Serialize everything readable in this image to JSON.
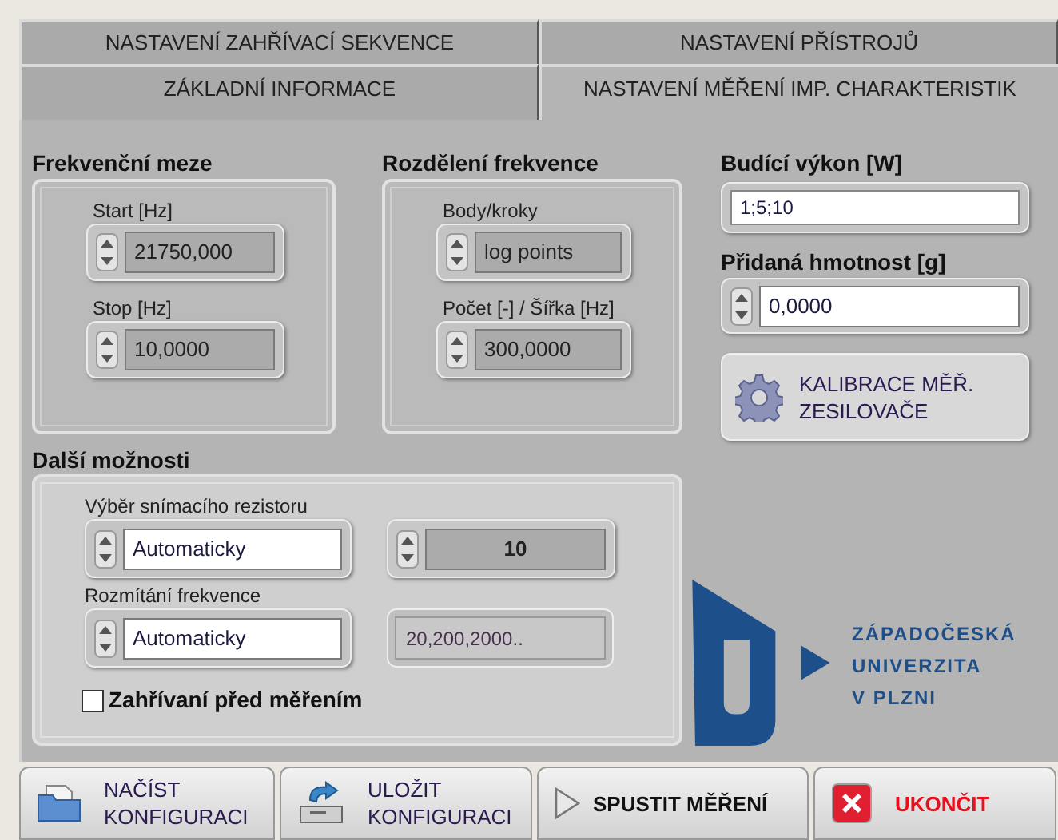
{
  "tab_rows": [
    {
      "tabs": [
        {
          "label": "NASTAVENÍ ZAHŘÍVACÍ  SEKVENCE",
          "selected": false
        },
        {
          "label": "NASTAVENÍ PŘÍSTROJŮ",
          "selected": false
        }
      ]
    },
    {
      "tabs": [
        {
          "label": "ZÁKLADNÍ INFORMACE",
          "selected": false
        },
        {
          "label": "NASTAVENÍ MĚŘENÍ IMP. CHARAKTERISTIK",
          "selected": true
        }
      ]
    }
  ],
  "frequency_limits": {
    "title": "Frekvenční meze",
    "fields": [
      {
        "label": "Start [Hz]",
        "value": "21750,000",
        "disabled": true
      },
      {
        "label": "Stop [Hz]",
        "value": "10,0000",
        "disabled": true
      }
    ]
  },
  "frequency_division": {
    "title": "Rozdělení frekvence",
    "fields": [
      {
        "label": "Body/kroky",
        "value": "log points",
        "disabled": true
      },
      {
        "label": "Počet [-] / Šířka [Hz]",
        "value": "300,0000",
        "disabled": true
      }
    ]
  },
  "drive_power": {
    "title": "Budící výkon [W]",
    "value": "1;5;10"
  },
  "added_mass": {
    "title": "Přidaná hmotnost [g]",
    "value": "0,0000",
    "disabled": false
  },
  "calibration_button": {
    "label": "KALIBRACE MĚŘ. ZESILOVAČE"
  },
  "more_options": {
    "title": "Další možnosti",
    "resistor": {
      "label": "Výběr snímacího rezistoru",
      "mode": "Automaticky",
      "mode_disabled": false,
      "value": "10",
      "value_disabled": true
    },
    "sweep": {
      "label": "Rozmítání frekvence",
      "mode": "Automaticky",
      "mode_disabled": false,
      "value": "20,200,2000.."
    },
    "warmup": {
      "label": "Zahřívaní před měřením",
      "checked": false
    }
  },
  "logo": {
    "lines": [
      "ZÁPADOČESKÁ",
      "UNIVERZITA",
      "V PLZNI"
    ]
  },
  "footer_buttons": [
    {
      "kind": "open",
      "lines": [
        "NAČÍST",
        "KONFIGURACI"
      ]
    },
    {
      "kind": "save",
      "lines": [
        "ULOŽIT",
        "KONFIGURACI"
      ]
    },
    {
      "kind": "run",
      "lines": [
        "SPUSTIT MĚŘENÍ"
      ]
    },
    {
      "kind": "exit",
      "lines": [
        "UKONČIT"
      ]
    }
  ]
}
